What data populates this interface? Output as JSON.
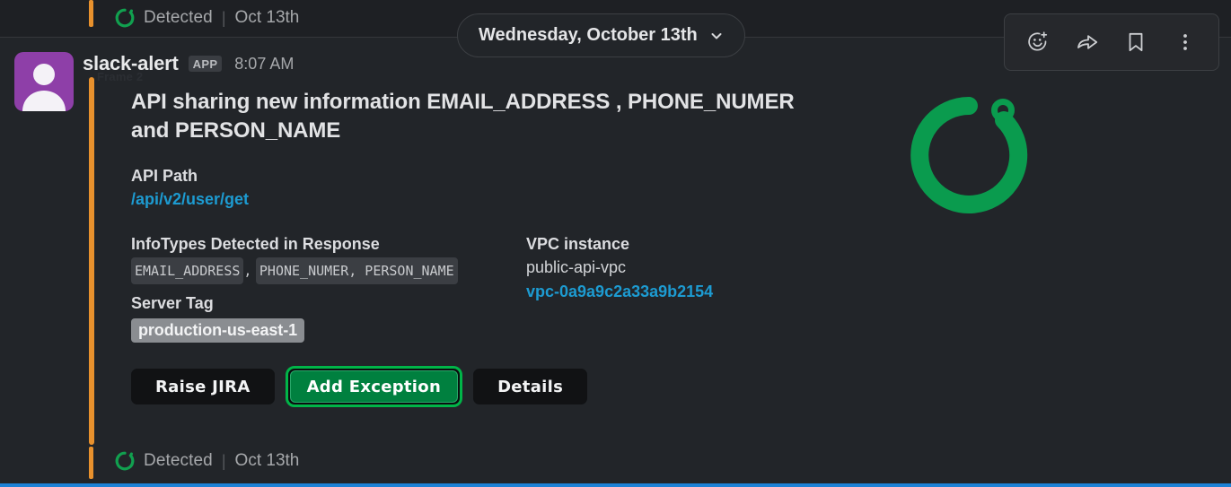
{
  "theme": {
    "background": "#222529",
    "top_strip": "#1e2024",
    "accent_orange": "#e8912d",
    "link_blue": "#1d9bd1",
    "brand_green": "#0a8a46",
    "primary_green": "#00803f",
    "focus_ring_green": "#00b548",
    "avatar_purple": "#8e3fa8",
    "bottom_accent_blue": "#1d82d6"
  },
  "previous_message_footer": {
    "status": "Detected",
    "separator": "|",
    "date": "Oct 13th",
    "icon": "green-ring-icon"
  },
  "date_divider": {
    "label": "Wednesday, October 13th",
    "chevron": "chevron-down-icon"
  },
  "hover_toolbar": {
    "actions": [
      {
        "name": "add-reaction",
        "icon": "emoji-plus-icon",
        "label": "Add reaction"
      },
      {
        "name": "forward",
        "icon": "share-arrow-icon",
        "label": "Forward message"
      },
      {
        "name": "save",
        "icon": "bookmark-icon",
        "label": "Save for later"
      },
      {
        "name": "more",
        "icon": "kebab-menu-icon",
        "label": "More actions"
      }
    ]
  },
  "message": {
    "avatar_icon": "person-avatar-icon",
    "sender": "slack-alert",
    "app_badge": "APP",
    "timestamp": "8:07 AM",
    "watermark": "Frame 2"
  },
  "attachment": {
    "title": "API sharing new information EMAIL_ADDRESS , PHONE_NUMER and PERSON_NAME",
    "api_path": {
      "label": "API Path",
      "value": "/api/v2/user/get"
    },
    "infotypes": {
      "label": "InfoTypes Detected in Response",
      "chips": [
        "EMAIL_ADDRESS",
        "PHONE_NUMER, PERSON_NAME"
      ],
      "separator": ","
    },
    "vpc": {
      "label": "VPC instance",
      "name": "public-api-vpc",
      "id": "vpc-0a9a9c2a33a9b2154"
    },
    "server_tag": {
      "label": "Server Tag",
      "value": "production-us-east-1"
    },
    "buttons": [
      {
        "label": "Raise JIRA",
        "style": "dark"
      },
      {
        "label": "Add Exception",
        "style": "primary-focused"
      },
      {
        "label": "Details",
        "style": "dark"
      }
    ],
    "logo_icon": "green-ring-logo-icon"
  },
  "message_footer": {
    "status": "Detected",
    "separator": "|",
    "date": "Oct 13th",
    "icon": "green-ring-icon"
  }
}
